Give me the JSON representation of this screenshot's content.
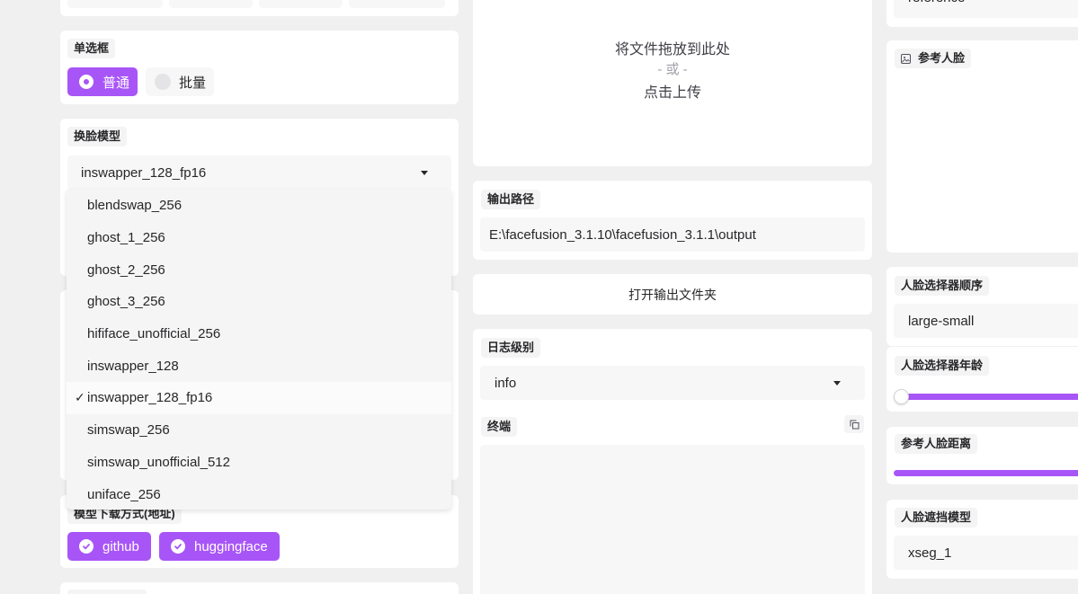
{
  "left": {
    "radio_section": {
      "label": "单选框",
      "options": [
        {
          "label": "普通",
          "selected": true
        },
        {
          "label": "批量",
          "selected": false
        }
      ]
    },
    "face_swap_model": {
      "label": "换脸模型",
      "selected_value": "inswapper_128_fp16",
      "options": [
        "blendswap_256",
        "ghost_1_256",
        "ghost_2_256",
        "ghost_3_256",
        "hififace_unofficial_256",
        "inswapper_128",
        "inswapper_128_fp16",
        "simswap_256",
        "simswap_unofficial_512",
        "uniface_256"
      ],
      "check_mark": "✓"
    },
    "download_providers": {
      "label": "模型下载方式(地址)",
      "options": [
        {
          "label": "github",
          "checked": true
        },
        {
          "label": "huggingface",
          "checked": true
        }
      ]
    }
  },
  "middle": {
    "upload": {
      "line1": "将文件拖放到此处",
      "line2": "- 或 -",
      "line3": "点击上传"
    },
    "output_path": {
      "label": "输出路径",
      "value": "E:\\facefusion_3.1.10\\facefusion_3.1.1\\output"
    },
    "open_output_button": "打开输出文件夹",
    "log_level": {
      "label": "日志级别",
      "value": "info"
    },
    "terminal": {
      "label": "终端"
    }
  },
  "right": {
    "top_value": "reference",
    "reference_face": {
      "label": "参考人脸"
    },
    "face_selector_order": {
      "label": "人脸选择器顺序",
      "value": "large-small"
    },
    "face_selector_age": {
      "label": "人脸选择器年龄"
    },
    "reference_face_distance": {
      "label": "参考人脸距离"
    },
    "face_occluder_model": {
      "label": "人脸遮挡模型",
      "value": "xseg_1"
    }
  },
  "colors": {
    "accent": "#a855f7",
    "background": "#f0f0f0",
    "card": "#ffffff"
  }
}
